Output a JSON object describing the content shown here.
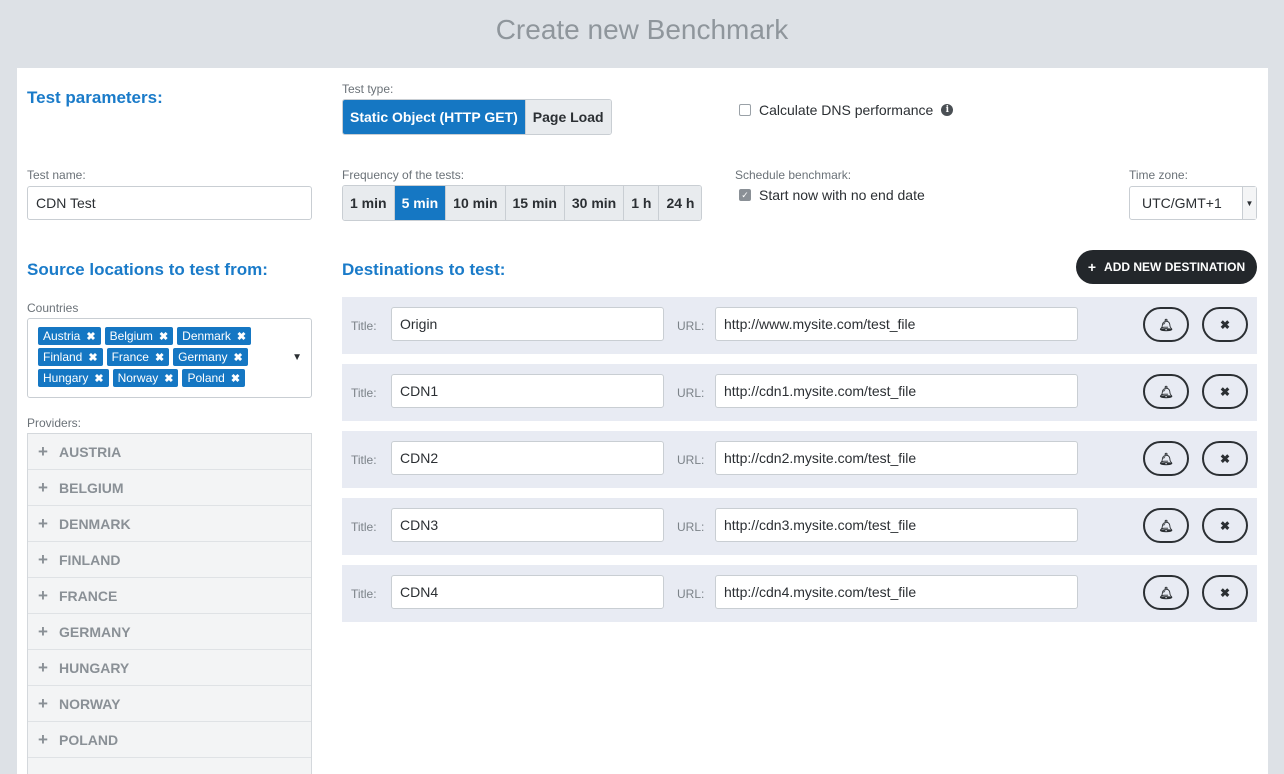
{
  "page_title": "Create new Benchmark",
  "test_parameters": {
    "heading": "Test parameters:",
    "test_type_label": "Test type:",
    "test_types": [
      "Static Object (HTTP GET)",
      "Page Load"
    ],
    "test_type_selected": "Static Object (HTTP GET)",
    "dns_checkbox_label": "Calculate DNS performance",
    "dns_checked": false,
    "test_name_label": "Test name:",
    "test_name_value": "CDN Test",
    "frequency_label": "Frequency of the tests:",
    "frequencies": [
      "1 min",
      "5 min",
      "10 min",
      "15 min",
      "30 min",
      "1 h",
      "24 h"
    ],
    "frequency_selected": "5 min",
    "schedule_label": "Schedule benchmark:",
    "schedule_checkbox_label": "Start now with no end date",
    "schedule_checked": true,
    "timezone_label": "Time zone:",
    "timezone_value": "UTC/GMT+1"
  },
  "sources": {
    "heading": "Source locations to test from:",
    "countries_label": "Countries",
    "countries": [
      "Austria",
      "Belgium",
      "Denmark",
      "Finland",
      "France",
      "Germany",
      "Hungary",
      "Norway",
      "Poland"
    ],
    "providers_label": "Providers:",
    "providers": [
      "AUSTRIA",
      "BELGIUM",
      "DENMARK",
      "FINLAND",
      "FRANCE",
      "GERMANY",
      "HUNGARY",
      "NORWAY",
      "POLAND"
    ]
  },
  "destinations": {
    "heading": "Destinations to test:",
    "add_button_label": "ADD NEW DESTINATION",
    "title_label": "Title:",
    "url_label": "URL:",
    "rows": [
      {
        "title": "Origin",
        "url": "http://www.mysite.com/test_file"
      },
      {
        "title": "CDN1",
        "url": "http://cdn1.mysite.com/test_file"
      },
      {
        "title": "CDN2",
        "url": "http://cdn2.mysite.com/test_file"
      },
      {
        "title": "CDN3",
        "url": "http://cdn3.mysite.com/test_file"
      },
      {
        "title": "CDN4",
        "url": "http://cdn4.mysite.com/test_file"
      }
    ]
  },
  "icons": {
    "info": "info-icon",
    "bell": "bell-icon",
    "remove": "close-icon",
    "plus": "plus-icon",
    "caret": "chevron-down-icon"
  },
  "colors": {
    "accent": "#1577c3",
    "heading": "#1a7bc9",
    "dark_button": "#23272b",
    "row_bg": "#e8ebf3"
  }
}
